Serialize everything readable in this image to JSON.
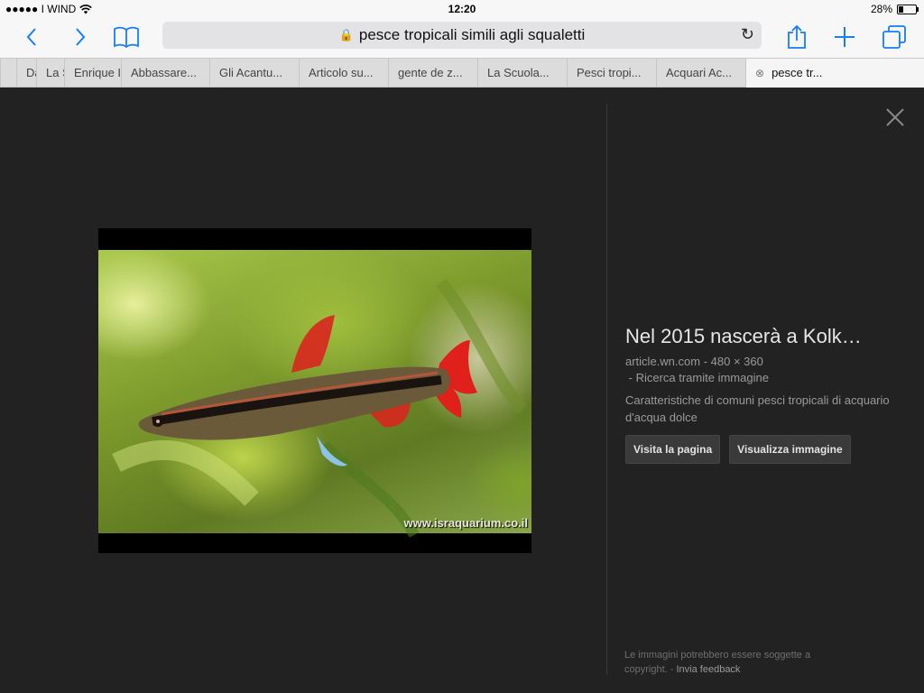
{
  "status": {
    "carrier": "●●●●● I WIND",
    "time": "12:20",
    "battery": "28%",
    "battery_level": 0.28
  },
  "toolbar": {
    "url": "pesce tropicali simili agli squaletti",
    "back_icon": "chevron-left-icon",
    "forward_icon": "chevron-right-icon",
    "bookmarks_icon": "book-icon",
    "share_icon": "share-icon",
    "add_icon": "plus-icon",
    "tabs_icon": "tabs-icon"
  },
  "tabs": [
    {
      "label": ""
    },
    {
      "label": "Da"
    },
    {
      "label": "La Scuola"
    },
    {
      "label": "Enrique Igl..."
    },
    {
      "label": "Abbassare..."
    },
    {
      "label": "Gli Acantu..."
    },
    {
      "label": "Articolo su..."
    },
    {
      "label": "gente de z..."
    },
    {
      "label": "La Scuola..."
    },
    {
      "label": "Pesci tropi..."
    },
    {
      "label": "Acquari Ac..."
    },
    {
      "label": "pesce tr...",
      "active": true
    }
  ],
  "image": {
    "watermark": "www.israquarium.co.il"
  },
  "info": {
    "title": "Nel 2015 nascerà a Kolk…",
    "domain": "article.wn.com",
    "size": "480 × 360",
    "search_by_image": "Ricerca tramite immagine",
    "description": "Caratteristiche di comuni pesci tropicali di acquario d'acqua dolce",
    "visit_button": "Visita la pagina",
    "view_button": "Visualizza immagine"
  },
  "footer": {
    "notice": "Le immagini potrebbero essere soggette a copyright.",
    "feedback": "Invia feedback"
  },
  "colors": {
    "accent": "#157efb",
    "background": "#222222",
    "fish_fin": "#d8261e"
  }
}
